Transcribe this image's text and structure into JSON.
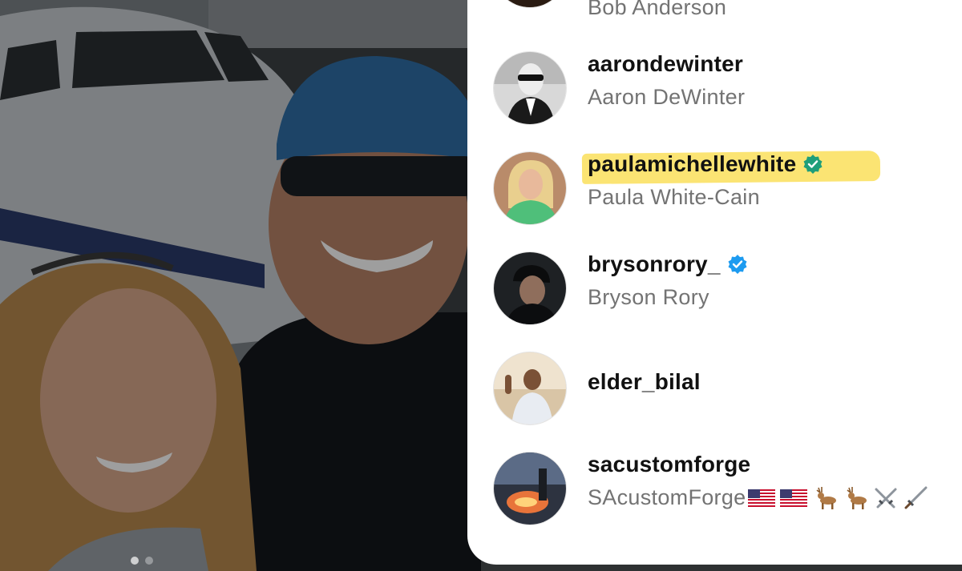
{
  "post": {
    "carousel_dots": [
      {
        "active": true
      },
      {
        "active": false
      }
    ]
  },
  "likes": {
    "users": [
      {
        "username": "",
        "full_name": "Bob Anderson",
        "verified": false
      },
      {
        "username": "aarondewinter",
        "full_name": "Aaron DeWinter",
        "verified": false
      },
      {
        "username": "paulamichellewhite",
        "full_name": "Paula White-Cain",
        "verified": true,
        "verified_color": "#1f9e7a",
        "highlighted": true
      },
      {
        "username": "brysonrory_",
        "full_name": "Bryson Rory",
        "verified": true,
        "verified_color": "#1d9bf0"
      },
      {
        "username": "elder_bilal",
        "full_name": "",
        "verified": false
      },
      {
        "username": "sacustomforge",
        "full_name": "SAcustomForge",
        "verified": false,
        "name_icons": [
          "us-flag-icon",
          "us-flag-icon",
          "deer-icon",
          "deer-icon",
          "crossed-swords-icon",
          "dagger-icon"
        ]
      }
    ]
  },
  "colors": {
    "highlight": "#fbe36b",
    "username": "#111111",
    "full_name": "#737373"
  }
}
